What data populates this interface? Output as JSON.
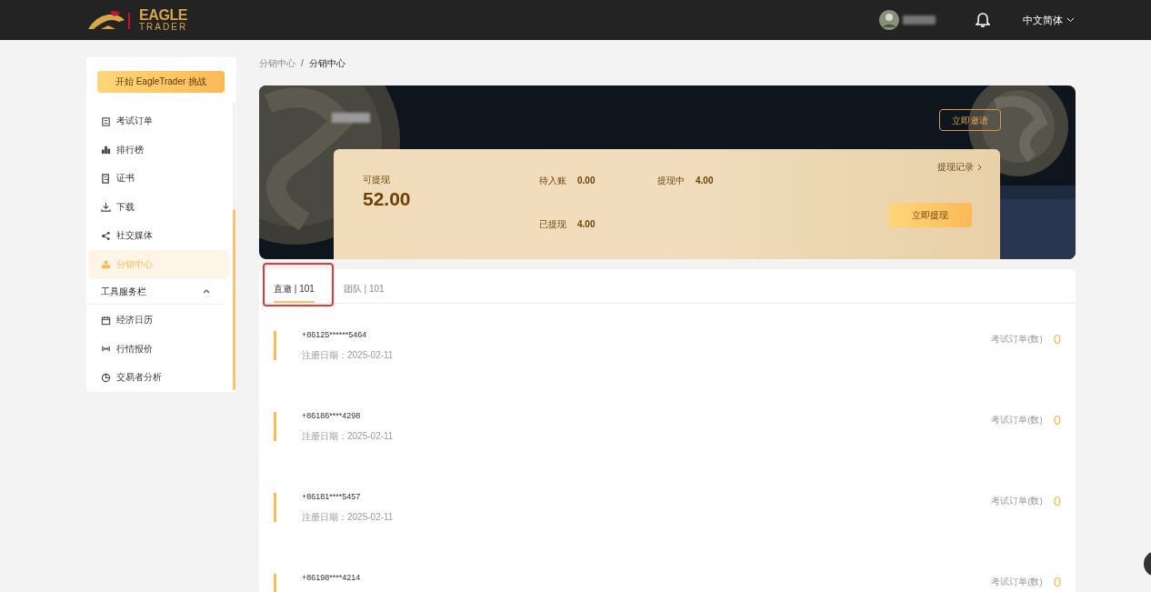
{
  "header": {
    "logo": {
      "word1": "EAGLE",
      "word2": "TRADER"
    },
    "language": "中文简体"
  },
  "sidebar": {
    "cta": "开始 EagleTrader 挑战",
    "items": [
      {
        "kind": "link",
        "label": "考试订单",
        "selected": false
      },
      {
        "kind": "link",
        "label": "排行榜",
        "selected": false
      },
      {
        "kind": "link",
        "label": "证书",
        "selected": false
      },
      {
        "kind": "link",
        "label": "下载",
        "selected": false
      },
      {
        "kind": "link",
        "label": "社交媒体",
        "selected": false
      },
      {
        "kind": "link",
        "label": "分销中心",
        "selected": true
      },
      {
        "kind": "section",
        "label": "工具服务栏",
        "expanded": true
      },
      {
        "kind": "link",
        "label": "经济日历",
        "selected": false
      },
      {
        "kind": "link",
        "label": "行情报价",
        "selected": false
      },
      {
        "kind": "link",
        "label": "交易者分析",
        "selected": false
      }
    ]
  },
  "breadcrumb": {
    "items": [
      "分销中心",
      "分销中心"
    ],
    "separator": "/"
  },
  "banner": {
    "invite_button": "立即邀请",
    "available_label": "可提现",
    "available_amount": "52.00",
    "stats": [
      {
        "label": "待入账",
        "value": "0.00"
      },
      {
        "label": "提现中",
        "value": "4.00"
      },
      {
        "label": "已提现",
        "value": "4.00"
      }
    ],
    "history_link": "提现记录",
    "withdraw_button": "立即提现"
  },
  "tabs": [
    {
      "label": "直邀",
      "separator": "|",
      "count": "101",
      "selected": true
    },
    {
      "label": "团队",
      "separator": "|",
      "count": "101",
      "selected": false
    }
  ],
  "invitees": [
    {
      "phone": "+86125******5464",
      "date": "注册日期：2025-02-11",
      "orders_label": "考试订单(数)",
      "orders": "0"
    },
    {
      "phone": "+86186****4298",
      "date": "注册日期：2025-02-11",
      "orders_label": "考试订单(数)",
      "orders": "0"
    },
    {
      "phone": "+86181****5457",
      "date": "注册日期：2025-02-11",
      "orders_label": "考试订单(数)",
      "orders": "0"
    },
    {
      "phone": "+86198****4214",
      "orders_label": "考试订单(数)",
      "orders": "0"
    }
  ]
}
